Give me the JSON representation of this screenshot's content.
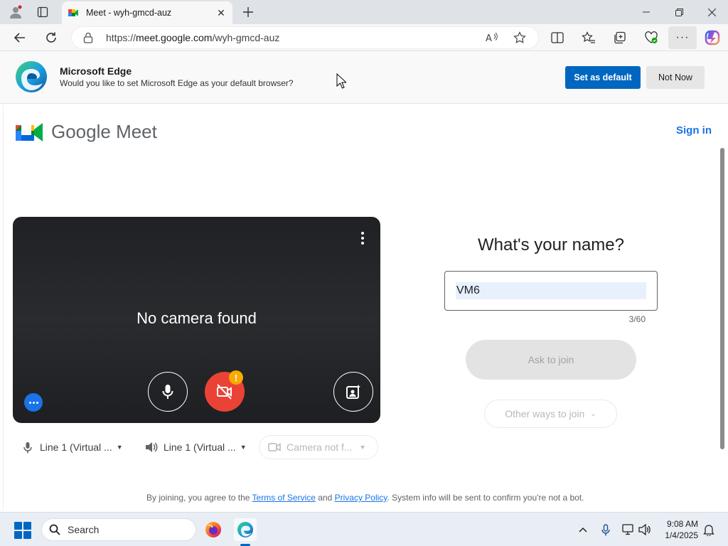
{
  "browser": {
    "tab_title": "Meet - wyh-gmcd-auz",
    "url_scheme": "https://",
    "url_host": "meet.google.com",
    "url_path": "/wyh-gmcd-auz"
  },
  "infobar": {
    "title": "Microsoft Edge",
    "subtitle": "Would you like to set Microsoft Edge as your default browser?",
    "set_default_label": "Set as default",
    "not_now_label": "Not Now"
  },
  "meet": {
    "brand": "Google Meet",
    "sign_in": "Sign in",
    "no_camera": "No camera found",
    "question": "What's your name?",
    "name_value": "VM6",
    "counter": "3/60",
    "ask_to_join": "Ask to join",
    "other_ways": "Other ways to join",
    "mic_device": "Line 1 (Virtual ...",
    "speaker_device": "Line 1 (Virtual ...",
    "camera_device": "Camera not f...",
    "warning_badge": "!",
    "footer": {
      "prefix": "By joining, you agree to the ",
      "terms": "Terms of Service",
      "and": " and ",
      "privacy": "Privacy Policy",
      "suffix": ". System info will be sent to confirm you're not a bot."
    }
  },
  "taskbar": {
    "search_label": "Search",
    "time": "9:08 AM",
    "date": "1/4/2025"
  },
  "colors": {
    "accent_blue": "#1a73e8",
    "edge_blue": "#0067c0",
    "cam_off_red": "#ea4335",
    "warning_yellow": "#f9ab00"
  }
}
